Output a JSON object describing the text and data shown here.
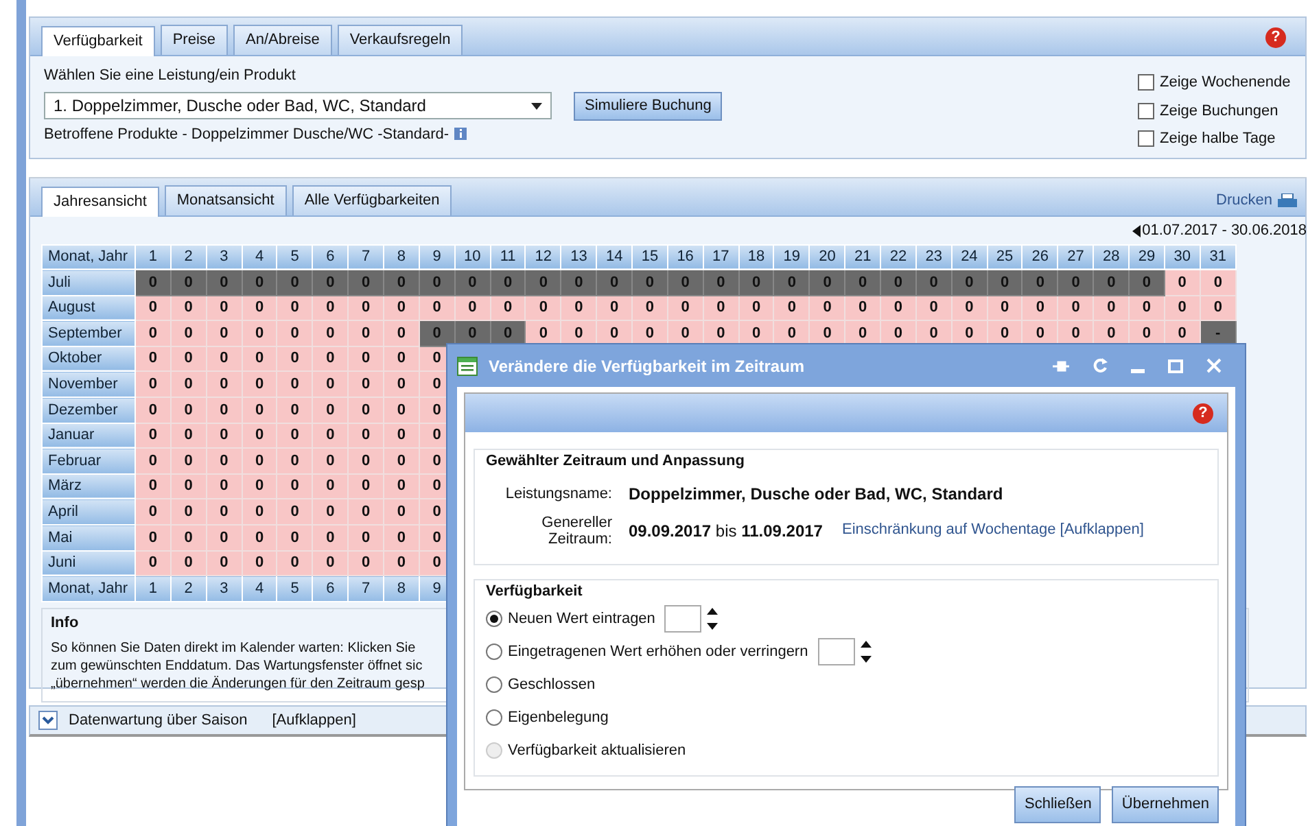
{
  "top_tabs": [
    {
      "label": "Verfügbarkeit",
      "selected": true
    },
    {
      "label": "Preise",
      "selected": false
    },
    {
      "label": "An/Abreise",
      "selected": false
    },
    {
      "label": "Verkaufsregeln",
      "selected": false
    }
  ],
  "help_mark": "?",
  "product": {
    "label": "Wählen Sie eine Leistung/ein Produkt",
    "value": "1. Doppelzimmer, Dusche oder Bad, WC, Standard",
    "button": "Simuliere Buchung",
    "affected": "Betroffene Produkte - Doppelzimmer Dusche/WC -Standard-"
  },
  "options": [
    {
      "label": "Zeige Wochenende",
      "checked": false
    },
    {
      "label": "Zeige Buchungen",
      "checked": false
    },
    {
      "label": "Zeige halbe Tage",
      "checked": false
    }
  ],
  "view_tabs": [
    {
      "label": "Jahresansicht",
      "selected": true
    },
    {
      "label": "Monatsansicht",
      "selected": false
    },
    {
      "label": "Alle Verfügbarkeiten",
      "selected": false
    }
  ],
  "print_link": "Drucken",
  "date_range": "01.07.2017 - 30.06.2018",
  "calendar": {
    "corner": "Monat, Jahr",
    "days": [
      "1",
      "2",
      "3",
      "4",
      "5",
      "6",
      "7",
      "8",
      "9",
      "10",
      "11",
      "12",
      "13",
      "14",
      "15",
      "16",
      "17",
      "18",
      "19",
      "20",
      "21",
      "22",
      "23",
      "24",
      "25",
      "26",
      "27",
      "28",
      "29",
      "30",
      "31"
    ],
    "rows": [
      {
        "month": "Juli",
        "cells": [
          {
            "value": "0",
            "closed": true
          },
          {
            "value": "0",
            "closed": true
          },
          {
            "value": "0",
            "closed": true
          },
          {
            "value": "0",
            "closed": true
          },
          {
            "value": "0",
            "closed": true
          },
          {
            "value": "0",
            "closed": true
          },
          {
            "value": "0",
            "closed": true
          },
          {
            "value": "0",
            "closed": true
          },
          {
            "value": "0",
            "closed": true
          },
          {
            "value": "0",
            "closed": true
          },
          {
            "value": "0",
            "closed": true
          },
          {
            "value": "0",
            "closed": true
          },
          {
            "value": "0",
            "closed": true
          },
          {
            "value": "0",
            "closed": true
          },
          {
            "value": "0",
            "closed": true
          },
          {
            "value": "0",
            "closed": true
          },
          {
            "value": "0",
            "closed": true
          },
          {
            "value": "0",
            "closed": true
          },
          {
            "value": "0",
            "closed": true
          },
          {
            "value": "0",
            "closed": true
          },
          {
            "value": "0",
            "closed": true
          },
          {
            "value": "0",
            "closed": true
          },
          {
            "value": "0",
            "closed": true
          },
          {
            "value": "0",
            "closed": true
          },
          {
            "value": "0",
            "closed": true
          },
          {
            "value": "0",
            "closed": true
          },
          {
            "value": "0",
            "closed": true
          },
          {
            "value": "0",
            "closed": true
          },
          {
            "value": "0",
            "closed": true
          },
          {
            "value": "0",
            "closed": false
          },
          {
            "value": "0",
            "closed": false
          }
        ]
      },
      {
        "month": "August",
        "cells": [
          {
            "value": "0",
            "closed": false
          },
          {
            "value": "0",
            "closed": false
          },
          {
            "value": "0",
            "closed": false
          },
          {
            "value": "0",
            "closed": false
          },
          {
            "value": "0",
            "closed": false
          },
          {
            "value": "0",
            "closed": false
          },
          {
            "value": "0",
            "closed": false
          },
          {
            "value": "0",
            "closed": false
          },
          {
            "value": "0",
            "closed": false
          },
          {
            "value": "0",
            "closed": false
          },
          {
            "value": "0",
            "closed": false
          },
          {
            "value": "0",
            "closed": false
          },
          {
            "value": "0",
            "closed": false
          },
          {
            "value": "0",
            "closed": false
          },
          {
            "value": "0",
            "closed": false
          },
          {
            "value": "0",
            "closed": false
          },
          {
            "value": "0",
            "closed": false
          },
          {
            "value": "0",
            "closed": false
          },
          {
            "value": "0",
            "closed": false
          },
          {
            "value": "0",
            "closed": false
          },
          {
            "value": "0",
            "closed": false
          },
          {
            "value": "0",
            "closed": false
          },
          {
            "value": "0",
            "closed": false
          },
          {
            "value": "0",
            "closed": false
          },
          {
            "value": "0",
            "closed": false
          },
          {
            "value": "0",
            "closed": false
          },
          {
            "value": "0",
            "closed": false
          },
          {
            "value": "0",
            "closed": false
          },
          {
            "value": "0",
            "closed": false
          },
          {
            "value": "0",
            "closed": false
          },
          {
            "value": "0",
            "closed": false
          }
        ]
      },
      {
        "month": "September",
        "cells": [
          {
            "value": "0",
            "closed": false
          },
          {
            "value": "0",
            "closed": false
          },
          {
            "value": "0",
            "closed": false
          },
          {
            "value": "0",
            "closed": false
          },
          {
            "value": "0",
            "closed": false
          },
          {
            "value": "0",
            "closed": false
          },
          {
            "value": "0",
            "closed": false
          },
          {
            "value": "0",
            "closed": false
          },
          {
            "value": "0",
            "closed": true
          },
          {
            "value": "0",
            "closed": true
          },
          {
            "value": "0",
            "closed": true
          },
          {
            "value": "0",
            "closed": false
          },
          {
            "value": "0",
            "closed": false
          },
          {
            "value": "0",
            "closed": false
          },
          {
            "value": "0",
            "closed": false
          },
          {
            "value": "0",
            "closed": false
          },
          {
            "value": "0",
            "closed": false
          },
          {
            "value": "0",
            "closed": false
          },
          {
            "value": "0",
            "closed": false
          },
          {
            "value": "0",
            "closed": false
          },
          {
            "value": "0",
            "closed": false
          },
          {
            "value": "0",
            "closed": false
          },
          {
            "value": "0",
            "closed": false
          },
          {
            "value": "0",
            "closed": false
          },
          {
            "value": "0",
            "closed": false
          },
          {
            "value": "0",
            "closed": false
          },
          {
            "value": "0",
            "closed": false
          },
          {
            "value": "0",
            "closed": false
          },
          {
            "value": "0",
            "closed": false
          },
          {
            "value": "0",
            "closed": false
          },
          {
            "value": "-",
            "closed": true
          }
        ]
      },
      {
        "month": "Oktober",
        "cells": [
          {
            "value": "0",
            "closed": false
          },
          {
            "value": "0",
            "closed": false
          },
          {
            "value": "0",
            "closed": false
          },
          {
            "value": "0",
            "closed": false
          },
          {
            "value": "0",
            "closed": false
          },
          {
            "value": "0",
            "closed": false
          },
          {
            "value": "0",
            "closed": false
          },
          {
            "value": "0",
            "closed": false
          },
          {
            "value": "0",
            "closed": false
          }
        ]
      },
      {
        "month": "November",
        "cells": [
          {
            "value": "0",
            "closed": false
          },
          {
            "value": "0",
            "closed": false
          },
          {
            "value": "0",
            "closed": false
          },
          {
            "value": "0",
            "closed": false
          },
          {
            "value": "0",
            "closed": false
          },
          {
            "value": "0",
            "closed": false
          },
          {
            "value": "0",
            "closed": false
          },
          {
            "value": "0",
            "closed": false
          },
          {
            "value": "0",
            "closed": false
          }
        ]
      },
      {
        "month": "Dezember",
        "cells": [
          {
            "value": "0",
            "closed": false
          },
          {
            "value": "0",
            "closed": false
          },
          {
            "value": "0",
            "closed": false
          },
          {
            "value": "0",
            "closed": false
          },
          {
            "value": "0",
            "closed": false
          },
          {
            "value": "0",
            "closed": false
          },
          {
            "value": "0",
            "closed": false
          },
          {
            "value": "0",
            "closed": false
          },
          {
            "value": "0",
            "closed": false
          }
        ]
      },
      {
        "month": "Januar",
        "cells": [
          {
            "value": "0",
            "closed": false
          },
          {
            "value": "0",
            "closed": false
          },
          {
            "value": "0",
            "closed": false
          },
          {
            "value": "0",
            "closed": false
          },
          {
            "value": "0",
            "closed": false
          },
          {
            "value": "0",
            "closed": false
          },
          {
            "value": "0",
            "closed": false
          },
          {
            "value": "0",
            "closed": false
          },
          {
            "value": "0",
            "closed": false
          }
        ]
      },
      {
        "month": "Februar",
        "cells": [
          {
            "value": "0",
            "closed": false
          },
          {
            "value": "0",
            "closed": false
          },
          {
            "value": "0",
            "closed": false
          },
          {
            "value": "0",
            "closed": false
          },
          {
            "value": "0",
            "closed": false
          },
          {
            "value": "0",
            "closed": false
          },
          {
            "value": "0",
            "closed": false
          },
          {
            "value": "0",
            "closed": false
          },
          {
            "value": "0",
            "closed": false
          }
        ]
      },
      {
        "month": "März",
        "cells": [
          {
            "value": "0",
            "closed": false
          },
          {
            "value": "0",
            "closed": false
          },
          {
            "value": "0",
            "closed": false
          },
          {
            "value": "0",
            "closed": false
          },
          {
            "value": "0",
            "closed": false
          },
          {
            "value": "0",
            "closed": false
          },
          {
            "value": "0",
            "closed": false
          },
          {
            "value": "0",
            "closed": false
          },
          {
            "value": "0",
            "closed": false
          }
        ]
      },
      {
        "month": "April",
        "cells": [
          {
            "value": "0",
            "closed": false
          },
          {
            "value": "0",
            "closed": false
          },
          {
            "value": "0",
            "closed": false
          },
          {
            "value": "0",
            "closed": false
          },
          {
            "value": "0",
            "closed": false
          },
          {
            "value": "0",
            "closed": false
          },
          {
            "value": "0",
            "closed": false
          },
          {
            "value": "0",
            "closed": false
          },
          {
            "value": "0",
            "closed": false
          }
        ]
      },
      {
        "month": "Mai",
        "cells": [
          {
            "value": "0",
            "closed": false
          },
          {
            "value": "0",
            "closed": false
          },
          {
            "value": "0",
            "closed": false
          },
          {
            "value": "0",
            "closed": false
          },
          {
            "value": "0",
            "closed": false
          },
          {
            "value": "0",
            "closed": false
          },
          {
            "value": "0",
            "closed": false
          },
          {
            "value": "0",
            "closed": false
          },
          {
            "value": "0",
            "closed": false
          }
        ]
      },
      {
        "month": "Juni",
        "cells": [
          {
            "value": "0",
            "closed": false
          },
          {
            "value": "0",
            "closed": false
          },
          {
            "value": "0",
            "closed": false
          },
          {
            "value": "0",
            "closed": false
          },
          {
            "value": "0",
            "closed": false
          },
          {
            "value": "0",
            "closed": false
          },
          {
            "value": "0",
            "closed": false
          },
          {
            "value": "0",
            "closed": false
          },
          {
            "value": "0",
            "closed": false
          }
        ]
      }
    ],
    "footer": {
      "label": "Monat, Jahr",
      "days": [
        "1",
        "2",
        "3",
        "4",
        "5",
        "6",
        "7",
        "8",
        "9"
      ]
    }
  },
  "info": {
    "title": "Info",
    "lines": [
      "So können Sie Daten direkt im Kalender warten: Klicken Sie",
      "zum gewünschten Enddatum. Das Wartungsfenster öffnet sic",
      "„übernehmen“ werden die Änderungen für den Zeitraum gesp"
    ]
  },
  "season_bar": {
    "label": "Datenwartung über Saison",
    "link": "[Aufklappen]"
  },
  "dialog": {
    "title": "Verändere die Verfügbarkeit im Zeitraum",
    "help_mark": "?",
    "section": "Gewählter Zeitraum und Anpassung",
    "fields": [
      {
        "label": "Leistungsname:",
        "value": "Doppelzimmer, Dusche oder Bad, WC, Standard"
      },
      {
        "label": "Genereller Zeitraum:",
        "value": "**09.09.2017** bis **11.09.2017**",
        "link": "Einschränkung auf Wochentage [Aufklappen]"
      }
    ],
    "availability_title": "Verfügbarkeit",
    "choices": [
      {
        "label": "Neuen Wert eintragen",
        "kind": "number",
        "selected": true,
        "disabled": false
      },
      {
        "label": "Eingetragenen Wert erhöhen oder verringern",
        "kind": "number",
        "selected": false,
        "disabled": false
      },
      {
        "label": "Geschlossen",
        "kind": "plain",
        "selected": false,
        "disabled": false
      },
      {
        "label": "Eigenbelegung",
        "kind": "plain",
        "selected": false,
        "disabled": false
      },
      {
        "label": "Verfügbarkeit aktualisieren",
        "kind": "plain",
        "selected": false,
        "disabled": true
      }
    ],
    "buttons": [
      "Schließen",
      "Übernehmen"
    ]
  }
}
